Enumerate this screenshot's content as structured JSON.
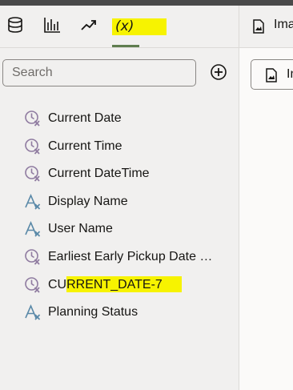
{
  "tabs": [
    {
      "name": "data-source-icon"
    },
    {
      "name": "bar-chart-icon"
    },
    {
      "name": "trend-icon"
    },
    {
      "name": "variables-tab",
      "label": "(x)"
    }
  ],
  "search": {
    "placeholder": "Search",
    "value": ""
  },
  "items": [
    {
      "label": "Current Date",
      "icon": "clock-variable-icon"
    },
    {
      "label": "Current Time",
      "icon": "clock-variable-icon"
    },
    {
      "label": "Current DateTime",
      "icon": "clock-variable-icon"
    },
    {
      "label": "Display Name",
      "icon": "text-variable-icon"
    },
    {
      "label": "User Name",
      "icon": "text-variable-icon"
    },
    {
      "label": "Earliest Early Pickup Date …",
      "icon": "clock-variable-icon"
    },
    {
      "label": "CURRENT_DATE-7",
      "icon": "clock-variable-icon"
    },
    {
      "label": "Planning Status",
      "icon": "text-variable-icon"
    }
  ],
  "right": {
    "tab_label": "Ima",
    "button_label": "In"
  },
  "colors": {
    "highlight": "#f7f300",
    "icon": "#8f7ba0",
    "text_icon": "#5a89a8",
    "active_tab": "#5f7d4f"
  }
}
